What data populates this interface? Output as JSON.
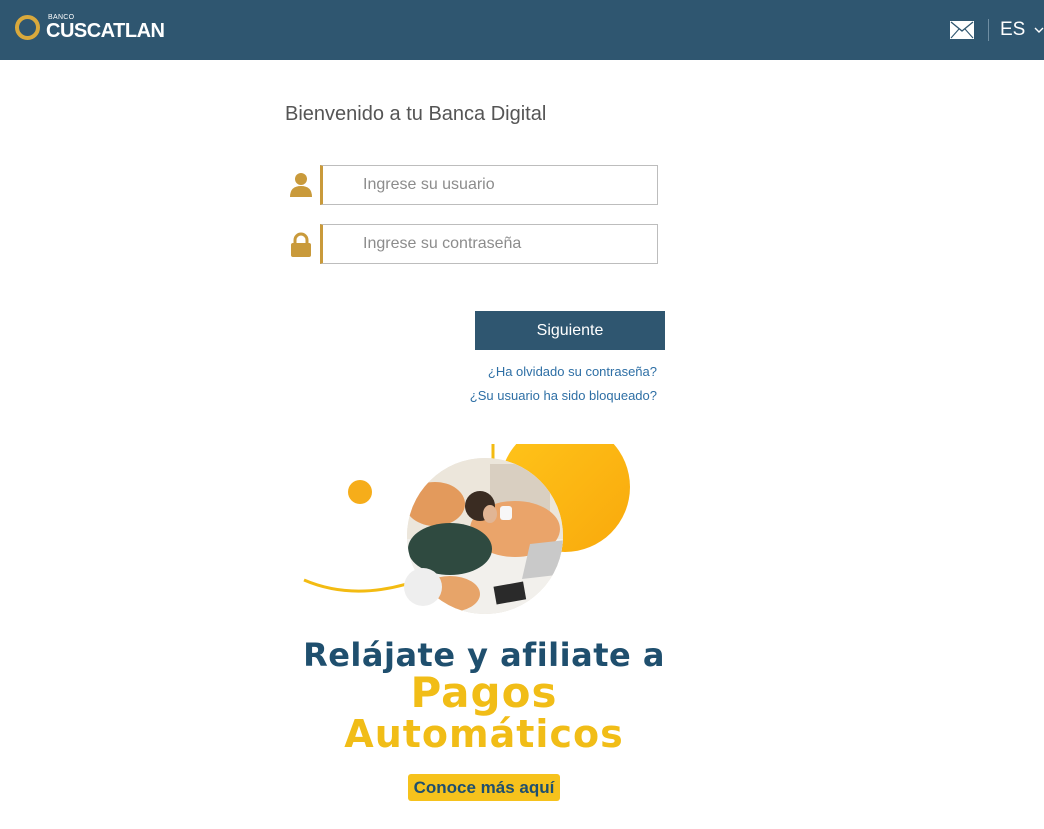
{
  "header": {
    "logo_small": "BANCO",
    "logo_name": "CUSCATLAN",
    "language": "ES"
  },
  "login": {
    "welcome": "Bienvenido a tu Banca Digital",
    "username_placeholder": "Ingrese su usuario",
    "password_placeholder": "Ingrese su contraseña",
    "next_label": "Siguiente",
    "forgot_password": "¿Ha olvidado su contraseña?",
    "user_blocked": "¿Su usuario ha sido bloqueado?"
  },
  "promo": {
    "line1": "Relájate y afiliate a",
    "line2": "Pagos",
    "line3": "Automáticos",
    "cta": "Conoce más aquí"
  },
  "colors": {
    "brand_dark": "#2f5670",
    "accent_gold": "#c99a3b",
    "promo_yellow": "#f1bd17",
    "link_blue": "#2e6fa5"
  },
  "icons": [
    "mail-icon",
    "chevron-down-icon",
    "user-icon",
    "lock-icon"
  ]
}
